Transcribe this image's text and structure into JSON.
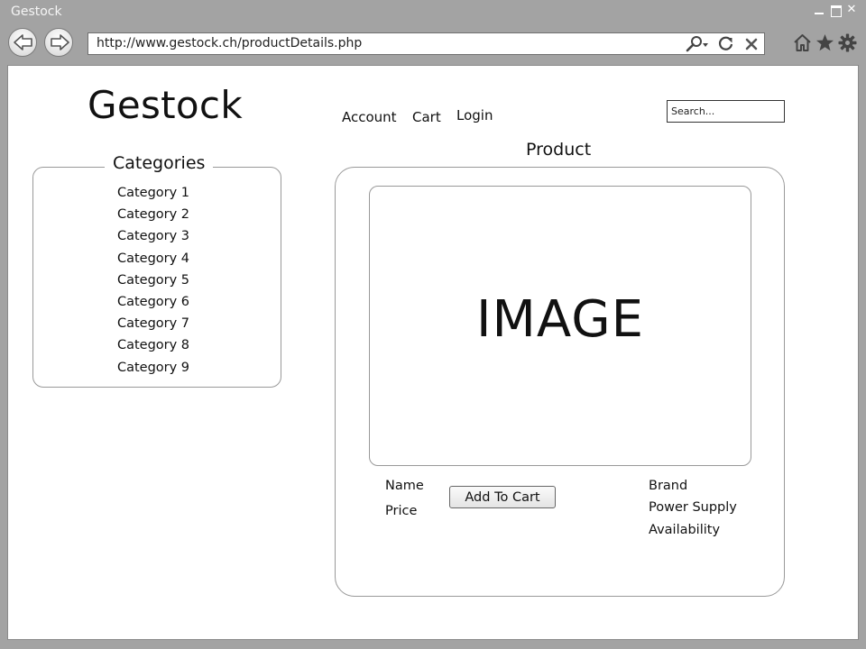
{
  "window": {
    "title": "Gestock"
  },
  "address_bar": {
    "url": "http://www.gestock.ch/productDetails.php"
  },
  "site": {
    "logo": "Gestock",
    "nav": {
      "account": "Account",
      "cart": "Cart",
      "login": "Login"
    },
    "search": {
      "placeholder": "Search..."
    }
  },
  "categories": {
    "title": "Categories",
    "items": [
      "Category 1",
      "Category 2",
      "Category 3",
      "Category 4",
      "Category 5",
      "Category 6",
      "Category 7",
      "Category 8",
      "Category 9"
    ]
  },
  "product": {
    "heading": "Product",
    "image_label": "IMAGE",
    "name_label": "Name",
    "price_label": "Price",
    "add_to_cart": "Add To Cart",
    "brand_label": "Brand",
    "power_supply_label": "Power Supply",
    "availability_label": "Availability"
  },
  "icons": {
    "back": "back-arrow-icon",
    "forward": "forward-arrow-icon",
    "search": "search-icon",
    "refresh": "refresh-icon",
    "stop": "close-icon",
    "home": "home-icon",
    "favorites": "star-icon",
    "settings": "gear-icon"
  }
}
